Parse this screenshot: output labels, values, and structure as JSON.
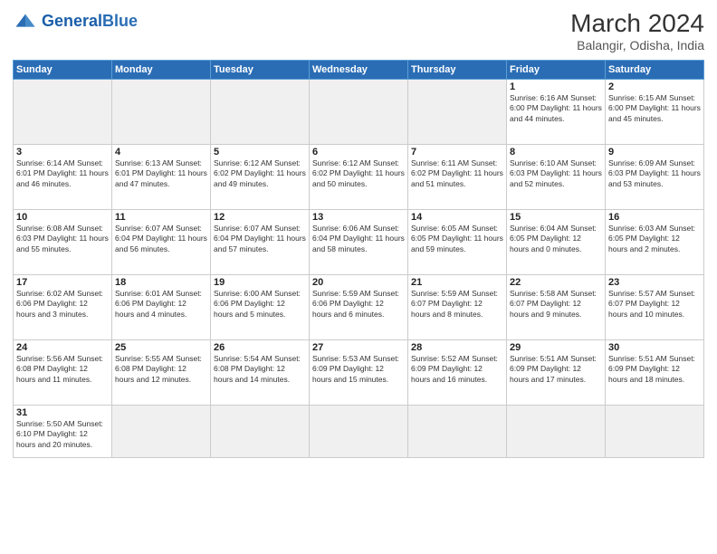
{
  "header": {
    "logo_general": "General",
    "logo_blue": "Blue",
    "month_year": "March 2024",
    "subtitle": "Balangir, Odisha, India"
  },
  "weekdays": [
    "Sunday",
    "Monday",
    "Tuesday",
    "Wednesday",
    "Thursday",
    "Friday",
    "Saturday"
  ],
  "weeks": [
    [
      {
        "day": "",
        "info": ""
      },
      {
        "day": "",
        "info": ""
      },
      {
        "day": "",
        "info": ""
      },
      {
        "day": "",
        "info": ""
      },
      {
        "day": "",
        "info": ""
      },
      {
        "day": "1",
        "info": "Sunrise: 6:16 AM\nSunset: 6:00 PM\nDaylight: 11 hours\nand 44 minutes."
      },
      {
        "day": "2",
        "info": "Sunrise: 6:15 AM\nSunset: 6:00 PM\nDaylight: 11 hours\nand 45 minutes."
      }
    ],
    [
      {
        "day": "3",
        "info": "Sunrise: 6:14 AM\nSunset: 6:01 PM\nDaylight: 11 hours\nand 46 minutes."
      },
      {
        "day": "4",
        "info": "Sunrise: 6:13 AM\nSunset: 6:01 PM\nDaylight: 11 hours\nand 47 minutes."
      },
      {
        "day": "5",
        "info": "Sunrise: 6:12 AM\nSunset: 6:02 PM\nDaylight: 11 hours\nand 49 minutes."
      },
      {
        "day": "6",
        "info": "Sunrise: 6:12 AM\nSunset: 6:02 PM\nDaylight: 11 hours\nand 50 minutes."
      },
      {
        "day": "7",
        "info": "Sunrise: 6:11 AM\nSunset: 6:02 PM\nDaylight: 11 hours\nand 51 minutes."
      },
      {
        "day": "8",
        "info": "Sunrise: 6:10 AM\nSunset: 6:03 PM\nDaylight: 11 hours\nand 52 minutes."
      },
      {
        "day": "9",
        "info": "Sunrise: 6:09 AM\nSunset: 6:03 PM\nDaylight: 11 hours\nand 53 minutes."
      }
    ],
    [
      {
        "day": "10",
        "info": "Sunrise: 6:08 AM\nSunset: 6:03 PM\nDaylight: 11 hours\nand 55 minutes."
      },
      {
        "day": "11",
        "info": "Sunrise: 6:07 AM\nSunset: 6:04 PM\nDaylight: 11 hours\nand 56 minutes."
      },
      {
        "day": "12",
        "info": "Sunrise: 6:07 AM\nSunset: 6:04 PM\nDaylight: 11 hours\nand 57 minutes."
      },
      {
        "day": "13",
        "info": "Sunrise: 6:06 AM\nSunset: 6:04 PM\nDaylight: 11 hours\nand 58 minutes."
      },
      {
        "day": "14",
        "info": "Sunrise: 6:05 AM\nSunset: 6:05 PM\nDaylight: 11 hours\nand 59 minutes."
      },
      {
        "day": "15",
        "info": "Sunrise: 6:04 AM\nSunset: 6:05 PM\nDaylight: 12 hours\nand 0 minutes."
      },
      {
        "day": "16",
        "info": "Sunrise: 6:03 AM\nSunset: 6:05 PM\nDaylight: 12 hours\nand 2 minutes."
      }
    ],
    [
      {
        "day": "17",
        "info": "Sunrise: 6:02 AM\nSunset: 6:06 PM\nDaylight: 12 hours\nand 3 minutes."
      },
      {
        "day": "18",
        "info": "Sunrise: 6:01 AM\nSunset: 6:06 PM\nDaylight: 12 hours\nand 4 minutes."
      },
      {
        "day": "19",
        "info": "Sunrise: 6:00 AM\nSunset: 6:06 PM\nDaylight: 12 hours\nand 5 minutes."
      },
      {
        "day": "20",
        "info": "Sunrise: 5:59 AM\nSunset: 6:06 PM\nDaylight: 12 hours\nand 6 minutes."
      },
      {
        "day": "21",
        "info": "Sunrise: 5:59 AM\nSunset: 6:07 PM\nDaylight: 12 hours\nand 8 minutes."
      },
      {
        "day": "22",
        "info": "Sunrise: 5:58 AM\nSunset: 6:07 PM\nDaylight: 12 hours\nand 9 minutes."
      },
      {
        "day": "23",
        "info": "Sunrise: 5:57 AM\nSunset: 6:07 PM\nDaylight: 12 hours\nand 10 minutes."
      }
    ],
    [
      {
        "day": "24",
        "info": "Sunrise: 5:56 AM\nSunset: 6:08 PM\nDaylight: 12 hours\nand 11 minutes."
      },
      {
        "day": "25",
        "info": "Sunrise: 5:55 AM\nSunset: 6:08 PM\nDaylight: 12 hours\nand 12 minutes."
      },
      {
        "day": "26",
        "info": "Sunrise: 5:54 AM\nSunset: 6:08 PM\nDaylight: 12 hours\nand 14 minutes."
      },
      {
        "day": "27",
        "info": "Sunrise: 5:53 AM\nSunset: 6:09 PM\nDaylight: 12 hours\nand 15 minutes."
      },
      {
        "day": "28",
        "info": "Sunrise: 5:52 AM\nSunset: 6:09 PM\nDaylight: 12 hours\nand 16 minutes."
      },
      {
        "day": "29",
        "info": "Sunrise: 5:51 AM\nSunset: 6:09 PM\nDaylight: 12 hours\nand 17 minutes."
      },
      {
        "day": "30",
        "info": "Sunrise: 5:51 AM\nSunset: 6:09 PM\nDaylight: 12 hours\nand 18 minutes."
      }
    ],
    [
      {
        "day": "31",
        "info": "Sunrise: 5:50 AM\nSunset: 6:10 PM\nDaylight: 12 hours\nand 20 minutes."
      },
      {
        "day": "",
        "info": ""
      },
      {
        "day": "",
        "info": ""
      },
      {
        "day": "",
        "info": ""
      },
      {
        "day": "",
        "info": ""
      },
      {
        "day": "",
        "info": ""
      },
      {
        "day": "",
        "info": ""
      }
    ]
  ]
}
